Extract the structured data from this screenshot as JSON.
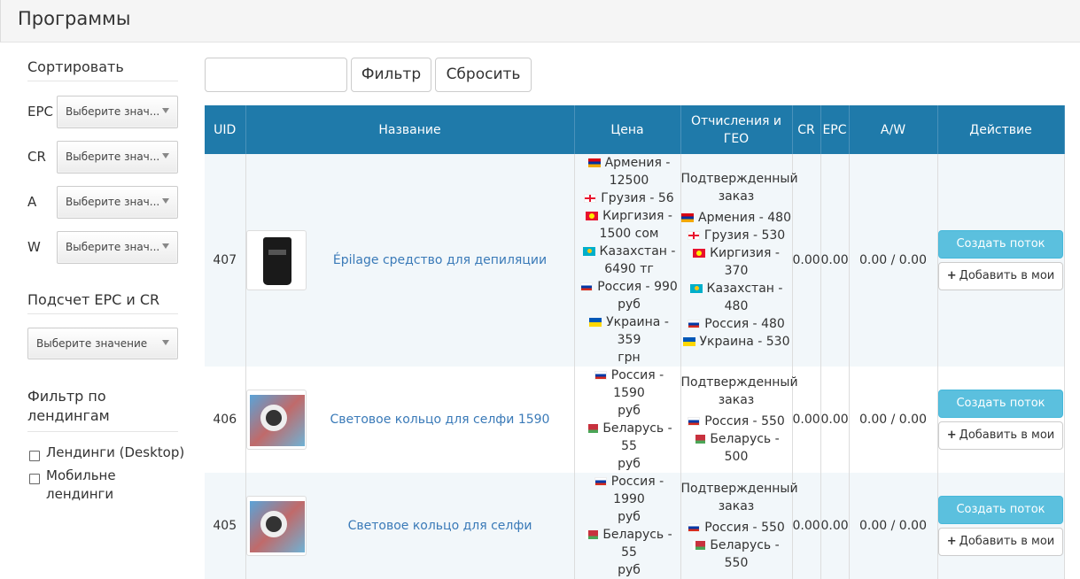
{
  "header": {
    "title": "Программы"
  },
  "sidebar": {
    "sort_title": "Сортировать",
    "sort_rows": [
      {
        "label": "EPC",
        "placeholder": "Выберите знач..."
      },
      {
        "label": "CR",
        "placeholder": "Выберите знач..."
      },
      {
        "label": "A",
        "placeholder": "Выберите знач..."
      },
      {
        "label": "W",
        "placeholder": "Выберите знач..."
      }
    ],
    "calc_title": "Подсчет EPC и CR",
    "calc_placeholder": "Выберите значение",
    "landing_title_line1": "Фильтр по",
    "landing_title_line2": "лендингам",
    "landing_options": [
      {
        "label": "Лендинги (Desktop)",
        "checked": false
      },
      {
        "label_line1": "Мобильне",
        "label_line2": "лендинги",
        "checked": false
      }
    ]
  },
  "filter": {
    "input_value": "",
    "filter_button": "Фильтр",
    "reset_button": "Сбросить"
  },
  "table": {
    "headers": {
      "uid": "UID",
      "name": "Название",
      "price": "Цена",
      "payout_line1": "Отчисления и",
      "payout_line2": "ГЕО",
      "cr": "CR",
      "epc": "EPC",
      "aw": "A/W",
      "action": "Действие"
    },
    "rows": [
      {
        "uid": "407",
        "image_icon": "black-package-image",
        "name": "Épilage средство для депиляции",
        "price_lines": [
          "Армения -",
          "12500",
          "Грузия - 56",
          "Киргизия -",
          "1500 сом",
          "Казахстан -",
          "6490 тг",
          "Россия - 990",
          "руб",
          "Украина - 359",
          "грн"
        ],
        "payout_lines": [
          "Подтвержденный",
          "заказ",
          "Армения - 480",
          "Грузия - 530",
          "Киргизия - 370",
          "Казахстан -",
          "480",
          "Россия - 480",
          "Украина - 530"
        ],
        "cr": "0.00",
        "epc": "0.00",
        "aw": "0.00 / 0.00",
        "create_label": "Создать поток",
        "add_label": "Добавить в мои"
      },
      {
        "uid": "406",
        "image_icon": "ring-light-image",
        "name": "Световое кольцо для селфи 1590",
        "price_lines": [
          "Россия - 1590",
          "руб",
          "Беларусь - 55",
          "руб"
        ],
        "payout_lines": [
          "Подтвержденный",
          "заказ",
          "Россия - 550",
          "Беларусь - 500"
        ],
        "cr": "0.00",
        "epc": "0.00",
        "aw": "0.00 / 0.00",
        "create_label": "Создать поток",
        "add_label": "Добавить в мои"
      },
      {
        "uid": "405",
        "image_icon": "ring-light-image",
        "name": "Световое кольцо для селфи",
        "price_lines": [
          "Россия - 1990",
          "руб",
          "Беларусь - 55",
          "руб"
        ],
        "payout_lines": [
          "Подтвержденный",
          "заказ",
          "Россия - 550",
          "Беларусь - 550"
        ],
        "cr": "0.00",
        "epc": "0.00",
        "aw": "0.00 / 0.00",
        "create_label": "Создать поток",
        "add_label": "Добавить в мои"
      }
    ]
  }
}
